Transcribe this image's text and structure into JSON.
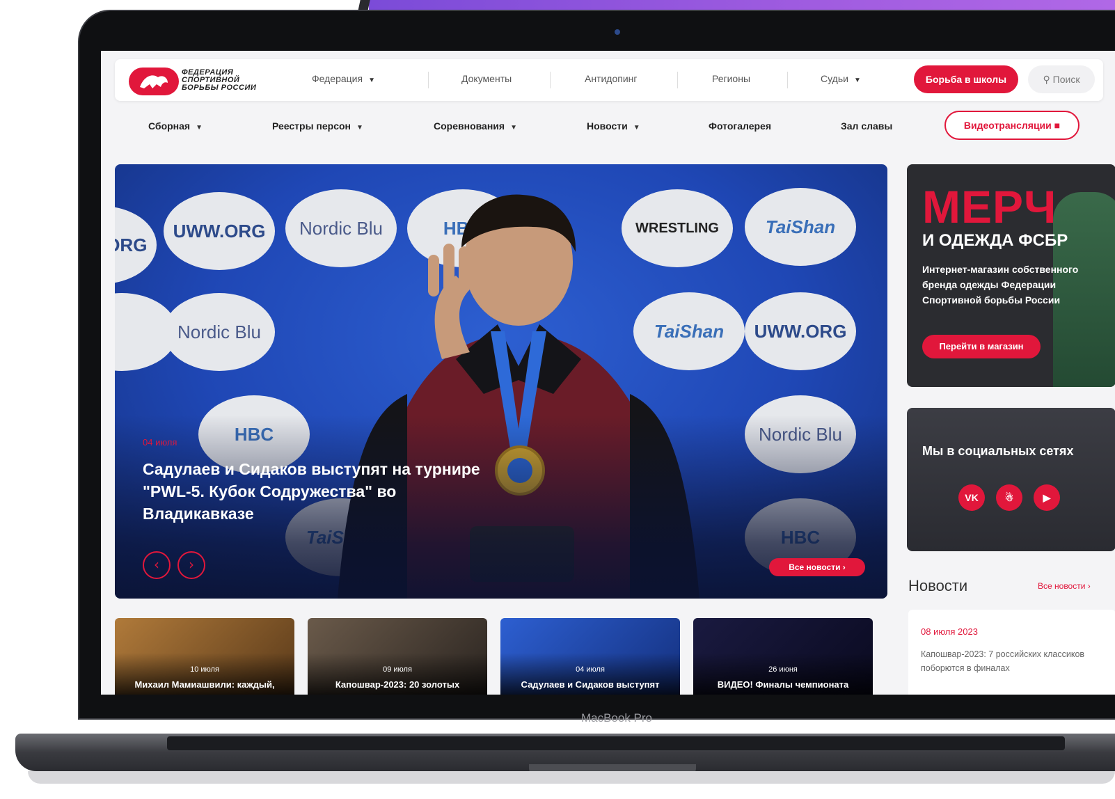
{
  "device": {
    "label": "MacBook Pro"
  },
  "logo": {
    "line1": "ФЕДЕРАЦИЯ",
    "line2": "СПОРТИВНОЙ",
    "line3": "БОРЬБЫ РОССИИ"
  },
  "topnav": {
    "items": [
      "Федерация",
      "Документы",
      "Антидопинг",
      "Регионы",
      "Судьи"
    ],
    "cta": "Борьба в школы",
    "search": "Поиск"
  },
  "secnav": {
    "items": [
      "Сборная",
      "Реестры персон",
      "Соревнования",
      "Новости",
      "Фотогалерея",
      "Зал славы"
    ],
    "video": "Видеотрансляции"
  },
  "hero": {
    "sponsors": [
      "UWW.ORG",
      "Nordic Blu",
      "HBC",
      "WRESTLING",
      "TaiShan"
    ],
    "date": "04 июля",
    "title": "Садулаев и Сидаков выступят на турнире \"PWL-5. Кубок Содружества\" во Владикавказе",
    "all_news": "Все новости",
    "prev_icon": "chevron-left-icon",
    "next_icon": "chevron-right-icon"
  },
  "merch": {
    "title": "МЕРЧ",
    "subtitle": "И ОДЕЖДА ФСБР",
    "text": "Интернет-магазин собственного бренда одежды Федерации Спортивной борьбы России",
    "button": "Перейти в магазин"
  },
  "social": {
    "title": "Мы в социальных сетях",
    "icons": [
      "vk-icon",
      "ok-icon",
      "youtube-icon"
    ],
    "vk": "VK"
  },
  "news": {
    "heading": "Новости",
    "all": "Все новости",
    "card_date": "08 июля 2023",
    "card_text": "Капошвар-2023: 7 российских классиков поборются в финалах"
  },
  "thumbs": [
    {
      "date": "10 июля",
      "title": "Михаил Мамиашвили: каждый,"
    },
    {
      "date": "09 июля",
      "title": "Капошвар-2023: 20 золотых"
    },
    {
      "date": "04 июля",
      "title": "Садулаев и Сидаков выступят"
    },
    {
      "date": "26 июня",
      "title": "ВИДЕО! Финалы чемпионата"
    }
  ],
  "colors": {
    "accent": "#e1173b",
    "hero_blue": "#1f47b5",
    "dark_card": "#2b2c30"
  }
}
